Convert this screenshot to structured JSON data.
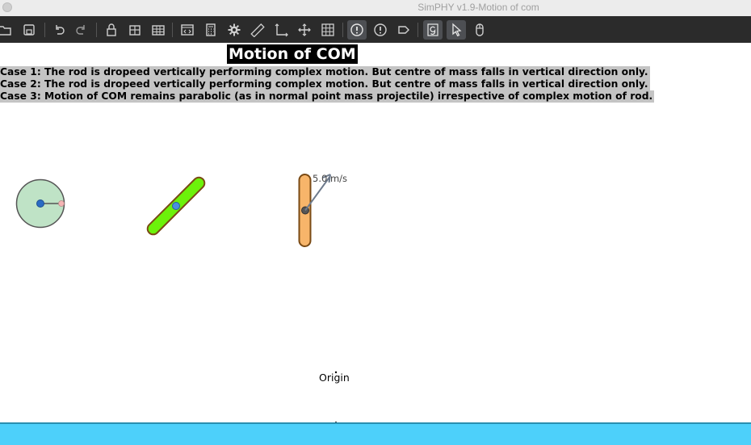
{
  "window": {
    "title": "SimPHY v1.9-Motion of com"
  },
  "toolbar": {
    "buttons": [
      {
        "name": "open-folder-icon"
      },
      {
        "name": "save-icon"
      },
      {
        "name": "undo-icon"
      },
      {
        "name": "redo-icon"
      },
      {
        "name": "lock-icon"
      },
      {
        "name": "table-icon"
      },
      {
        "name": "table-grid-icon"
      },
      {
        "name": "script-editor-icon"
      },
      {
        "name": "calculator-icon"
      },
      {
        "name": "gear-icon"
      },
      {
        "name": "ruler-icon"
      },
      {
        "name": "axes-icon"
      },
      {
        "name": "move-icon"
      },
      {
        "name": "grid-icon"
      },
      {
        "name": "alert-filled-icon",
        "active": true
      },
      {
        "name": "alert-outline-icon"
      },
      {
        "name": "tag-icon"
      },
      {
        "name": "gravity-icon",
        "active": true
      },
      {
        "name": "pointer-icon",
        "active": true
      },
      {
        "name": "mouse-icon"
      }
    ]
  },
  "canvas": {
    "heading": "Motion of COM",
    "cases": [
      "Case 1: The rod is dropeed vertically performing complex motion. But centre of mass falls in vertical direction only.",
      "Case 2: The rod is dropeed vertically performing complex motion. But centre of mass falls in vertical direction only.",
      "Case 3: Motion of COM remains parabolic (as in normal point mass projectile) irrespective of complex motion of rod."
    ],
    "velocity_label": "5.0 m/s",
    "origin_label": "Origin"
  },
  "colors": {
    "titlebar": "#ececec",
    "toolbar": "#2b2b2b",
    "disc_fill": "#bfe3c6",
    "rod2_fill": "#6cf20a",
    "rod3_fill": "#f7b56a",
    "bottom_bar": "#4dd0fa"
  }
}
